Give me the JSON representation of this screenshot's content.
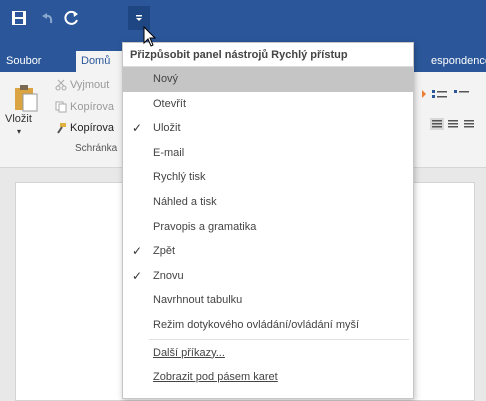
{
  "title_bar": {
    "bg_color": "#2b579a",
    "buttons": [
      {
        "name": "save-icon"
      },
      {
        "name": "undo-icon"
      },
      {
        "name": "redo-icon"
      },
      {
        "name": "customize-qat-icon"
      }
    ]
  },
  "tabs": {
    "file": "Soubor",
    "home": "Domů",
    "mailings": "espondence"
  },
  "ribbon": {
    "paste": "Vložit",
    "cut": "Vyjmout",
    "copy": "Kopírova",
    "format_painter": "Kopírova",
    "group_clipboard": "Schránka"
  },
  "qat_menu": {
    "header": "Přizpůsobit panel nástrojů Rychlý přístup",
    "items": [
      {
        "label": "Nový",
        "checked": false,
        "highlighted": true
      },
      {
        "label": "Otevřít",
        "checked": false
      },
      {
        "label": "Uložit",
        "checked": true
      },
      {
        "label": "E-mail",
        "checked": false
      },
      {
        "label": "Rychlý tisk",
        "checked": false
      },
      {
        "label": "Náhled a tisk",
        "checked": false
      },
      {
        "label": "Pravopis a gramatika",
        "checked": false
      },
      {
        "label": "Zpět",
        "checked": true
      },
      {
        "label": "Znovu",
        "checked": true
      },
      {
        "label": "Navrhnout tabulku",
        "checked": false
      },
      {
        "label": "Režim dotykového ovládání/ovládání myší",
        "checked": false
      }
    ],
    "more_commands": "Další příkazy...",
    "show_below": "Zobrazit pod pásem karet",
    "check_glyph": "✓"
  }
}
